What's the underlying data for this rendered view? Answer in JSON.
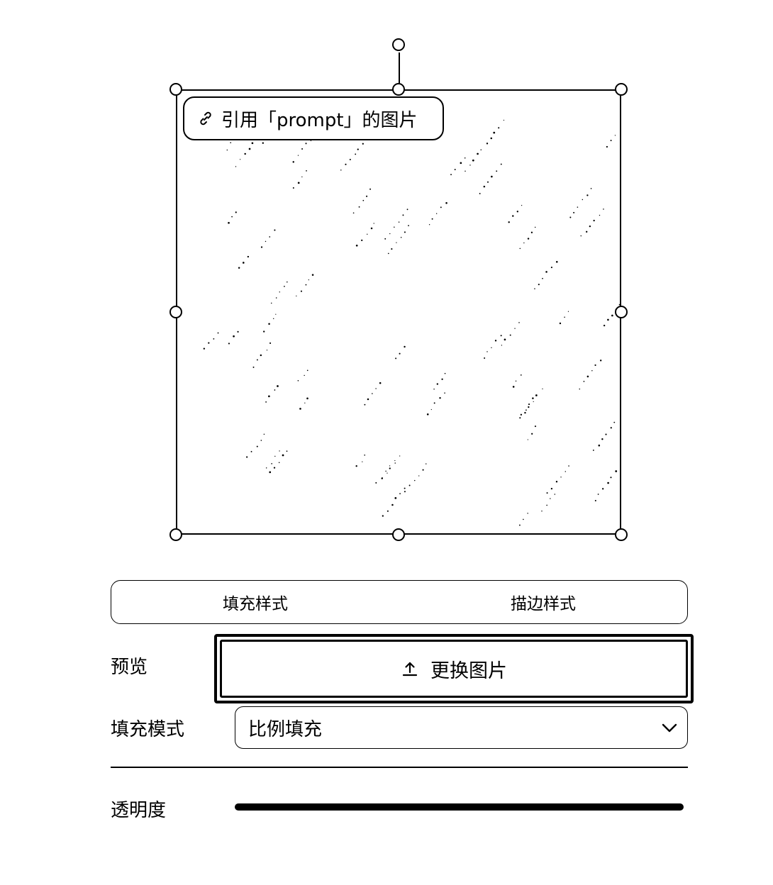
{
  "canvas": {
    "reference_label": "引用「prompt」的图片",
    "link_icon": "link-icon"
  },
  "tabs": [
    {
      "label": "填充样式"
    },
    {
      "label": "描边样式"
    }
  ],
  "preview": {
    "label": "预览",
    "button_label": "更换图片",
    "button_icon": "upload-icon"
  },
  "fill_mode": {
    "label": "填充模式",
    "value": "比例填充",
    "icon": "chevron-down-icon"
  },
  "opacity": {
    "label": "透明度",
    "value": 1.0
  }
}
